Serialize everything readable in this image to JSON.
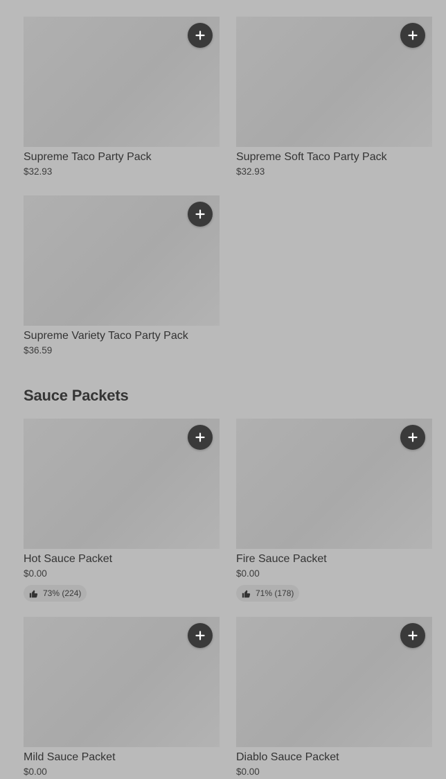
{
  "party_packs": {
    "items": [
      {
        "name": "Supreme Taco Party Pack",
        "price": "$32.93"
      },
      {
        "name": "Supreme Soft Taco Party Pack",
        "price": "$32.93"
      },
      {
        "name": "Supreme Variety Taco Party Pack",
        "price": "$36.59"
      }
    ]
  },
  "sauce_packets": {
    "title": "Sauce Packets",
    "items": [
      {
        "name": "Hot Sauce Packet",
        "price": "$0.00",
        "rating": "73% (224)"
      },
      {
        "name": "Fire Sauce Packet",
        "price": "$0.00",
        "rating": "71% (178)"
      },
      {
        "name": "Mild Sauce Packet",
        "price": "$0.00"
      },
      {
        "name": "Diablo Sauce Packet",
        "price": "$0.00"
      }
    ]
  },
  "icons": {
    "add": "plus-icon",
    "rating": "thumbs-up-icon"
  },
  "colors": {
    "background": "#bababa",
    "placeholder_image": "#ababab",
    "add_button": "#3a3a3a",
    "text": "#333333"
  }
}
